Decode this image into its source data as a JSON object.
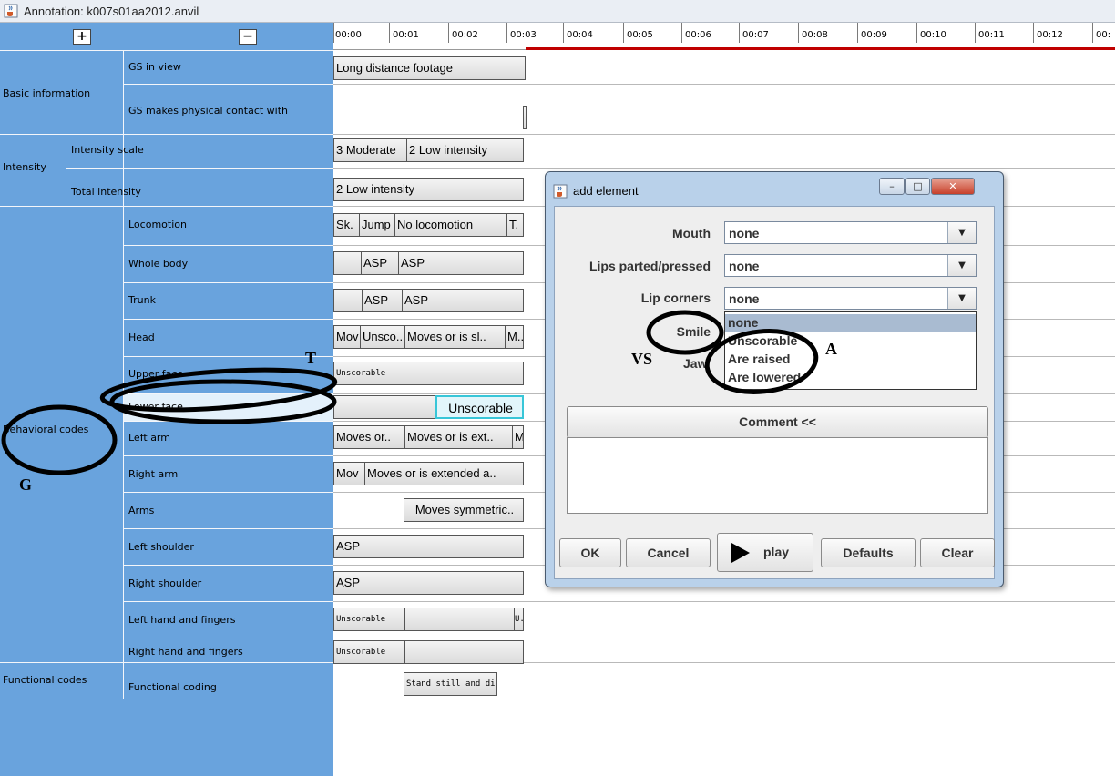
{
  "window": {
    "title": "Annotation: k007s01aa2012.anvil",
    "icon": "java-cup-icon"
  },
  "toolbar": {
    "expand_label": "+",
    "collapse_label": "−"
  },
  "tree": {
    "groups": [
      "Basic information",
      "Intensity",
      "Behavioral codes",
      "Functional codes"
    ],
    "intensity_scale_label": "Intensity scale",
    "total_intensity_label": "Total intensity",
    "tracks": {
      "gs_in_view": "GS in view",
      "gs_contact": "GS makes physical contact with",
      "locomotion": "Locomotion",
      "whole_body": "Whole body",
      "trunk": "Trunk",
      "head": "Head",
      "upper_face": "Upper face",
      "lower_face": "Lower face",
      "left_arm": "Left arm",
      "right_arm": "Right arm",
      "arms": "Arms",
      "left_shoulder": "Left shoulder",
      "right_shoulder": "Right shoulder",
      "left_hand": "Left hand and fingers",
      "right_hand": "Right hand and fingers",
      "functional_coding": "Functional coding"
    }
  },
  "timeline": {
    "ticks": [
      "00:00",
      "00:01",
      "00:02",
      "00:03",
      "00:04",
      "00:05",
      "00:06",
      "00:07",
      "00:08",
      "00:09",
      "00:10",
      "00:11",
      "00:12",
      "00:"
    ],
    "segments": {
      "gs_view": "Long distance footage",
      "intensity_1": "3 Moderate",
      "intensity_2": "2 Low intensity",
      "total_1": "2 Low intensity",
      "loco_1": "Sk.",
      "loco_2": "Jump",
      "loco_3": "No locomotion",
      "loco_4": "T.",
      "wb_1": "ASP",
      "wb_2": "ASP",
      "trunk_1": "ASP",
      "trunk_2": "ASP",
      "head_1": "Mov",
      "head_2": "Unsco..",
      "head_3": "Moves or is sl..",
      "head_4": "M..",
      "upper_face_1": "Unscorable",
      "lower_face_1": "Unscorable",
      "larm_1": "Moves or..",
      "larm_2": "Moves or is ext..",
      "larm_3": "M..",
      "rarm_1": "Mov",
      "rarm_2": "Moves or is extended a..",
      "arms_1": "Moves symmetric..",
      "lshoulder_1": "ASP",
      "rshoulder_1": "ASP",
      "lhand_1": "Unscorable",
      "lhand_2": "U..",
      "rhand_1": "Unscorable",
      "func_1": "Stand still and di.."
    }
  },
  "dialog": {
    "title": "add element",
    "icon": "java-cup-icon",
    "window_buttons": {
      "minimize": "minimize-icon",
      "maximize": "maximize-icon",
      "close": "close-icon"
    },
    "fields": {
      "mouth_label": "Mouth",
      "mouth_value": "none",
      "lips_label": "Lips parted/pressed",
      "lips_value": "none",
      "corners_label": "Lip corners",
      "corners_value": "none",
      "smile_label": "Smile",
      "jaw_label": "Jaw"
    },
    "dropdown_options": [
      "none",
      "Unscorable",
      "Are raised",
      "Are lowered"
    ],
    "comment_label": "Comment <<",
    "buttons": {
      "ok": "OK",
      "cancel": "Cancel",
      "play": "play",
      "defaults": "Defaults",
      "clear": "Clear"
    }
  },
  "annotations": {
    "t": "T",
    "a": "A",
    "vs": "VS",
    "g": "G"
  }
}
